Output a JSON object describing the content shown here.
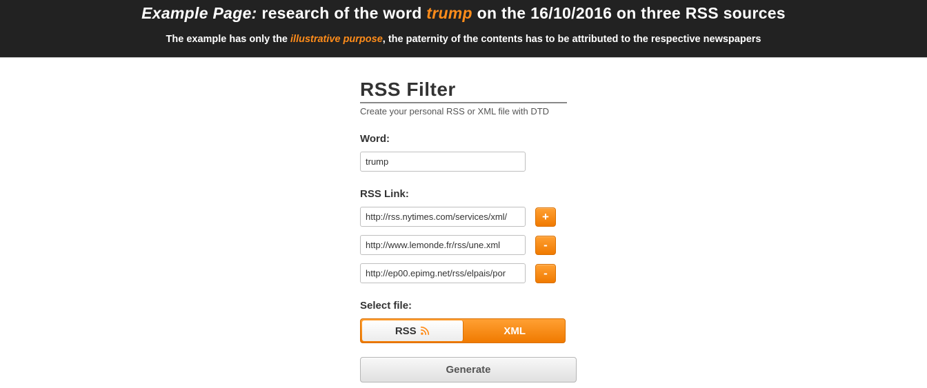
{
  "banner": {
    "prefix": "Example Page:",
    "mid1": " research of the word ",
    "highlight": "trump",
    "mid2": " on the 16/10/2016 on three RSS sources",
    "sub_pre": "The example has only the ",
    "sub_highlight": "illustrative purpose",
    "sub_post": ", the paternity of the contents has to be attributed to the respective newspapers"
  },
  "form": {
    "title": "RSS Filter",
    "subtitle": "Create your personal RSS or XML file with DTD",
    "word_label": "Word:",
    "word_value": "trump",
    "rss_label": "RSS Link:",
    "links": [
      {
        "value": "http://rss.nytimes.com/services/xml/",
        "btn": "+"
      },
      {
        "value": "http://www.lemonde.fr/rss/une.xml",
        "btn": "-"
      },
      {
        "value": "http://ep00.epimg.net/rss/elpais/por",
        "btn": "-"
      }
    ],
    "select_label": "Select file:",
    "tabs": {
      "rss": "RSS",
      "xml": "XML"
    },
    "generate": "Generate"
  }
}
